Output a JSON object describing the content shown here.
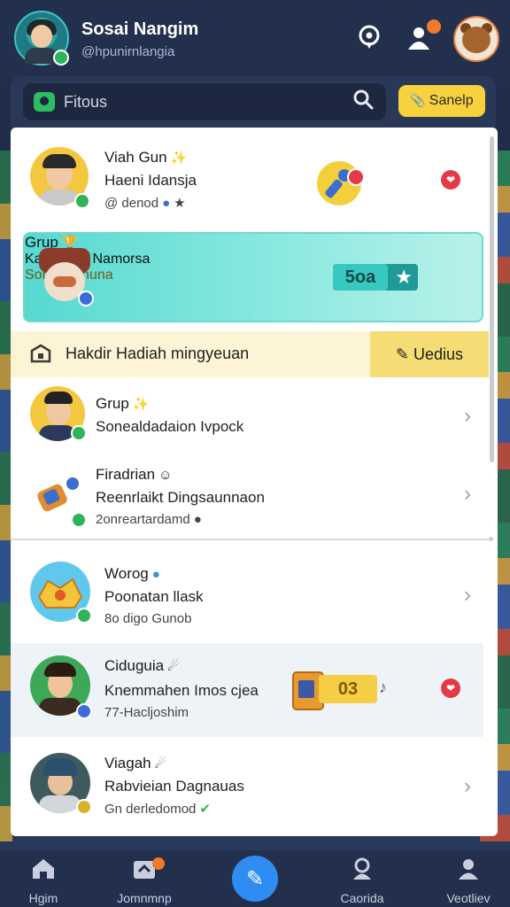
{
  "header": {
    "name": "Sosai Nangim",
    "handle": "@hpunirnlangia",
    "location_icon": "location-pin-icon",
    "notification_icon": "bell-people-icon"
  },
  "search": {
    "placeholder": "Fitous",
    "action_label": "Sanelp"
  },
  "cards": [
    {
      "title": "Viah Gun",
      "sub": "Haeni Idansja",
      "meta": "@ denod"
    },
    {
      "title": "Grup",
      "sub": "Kadimann Namorsa",
      "meta": "Sortien dnuna",
      "chip": "5oa"
    }
  ],
  "banner": {
    "text": "Hakdir Hadiah mingyeuan",
    "button": "Uedius"
  },
  "list": [
    {
      "title": "Grup",
      "sub": "Sonealdadaion Ivpock",
      "meta": ""
    },
    {
      "title": "Firadrian",
      "sub": "Reenrlaikt Dingsaunnaon",
      "meta": "2onreartardamd"
    },
    {
      "title": "Worog",
      "sub": "Poonatan llask",
      "meta": "8o digo Gunob"
    },
    {
      "title": "Ciduguia",
      "sub": "Knemmahen Imos cjea",
      "meta": "77-Hacljoshim",
      "chip": "03"
    },
    {
      "title": "Viagah",
      "sub": "Rabvieian Dagnauas",
      "meta": "Gn derledomod"
    }
  ],
  "bottom_nav": [
    {
      "label": "Hgim",
      "icon": "home-icon"
    },
    {
      "label": "Jomnmnp",
      "icon": "inbox-icon"
    },
    {
      "label": "",
      "icon": "pencil-icon"
    },
    {
      "label": "Caorida",
      "icon": "community-icon"
    },
    {
      "label": "Veotliev",
      "icon": "profile-icon"
    }
  ],
  "colors": {
    "header_bg": "#22304e",
    "accent_yellow": "#f7d13e",
    "accent_teal": "#56d9d0",
    "fab_blue": "#2f8cf1",
    "online_green": "#2fb45a",
    "alert_red": "#e53946"
  }
}
